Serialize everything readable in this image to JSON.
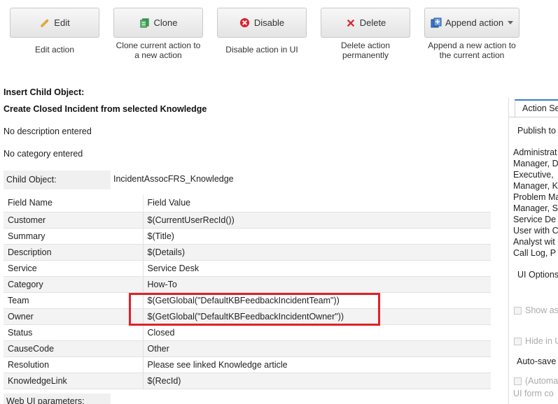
{
  "toolbar": {
    "edit": {
      "label": "Edit",
      "desc": "Edit action",
      "icon": "pencil-icon"
    },
    "clone": {
      "label": "Clone",
      "desc": "Clone current action to a new action",
      "icon": "clone-icon"
    },
    "disable": {
      "label": "Disable",
      "desc": "Disable action in UI",
      "icon": "disable-icon"
    },
    "delete": {
      "label": "Delete",
      "desc": "Delete action permanently",
      "icon": "delete-x-icon"
    },
    "append": {
      "label": "Append action",
      "desc": "Append a new action to the current action",
      "icon": "append-icon"
    }
  },
  "main": {
    "heading": "Insert Child Object:",
    "subheading": "Create Closed Incident from selected Knowledge",
    "description": "No description entered",
    "category": "No category entered",
    "child_object_label": "Child Object:",
    "child_object_value": "IncidentAssocFRS_Knowledge",
    "columns": [
      "Field Name",
      "Field Value"
    ],
    "rows": [
      {
        "name": "Customer",
        "value": "$(CurrentUserRecId())"
      },
      {
        "name": "Summary",
        "value": "$(Title)"
      },
      {
        "name": "Description",
        "value": "$(Details)"
      },
      {
        "name": "Service",
        "value": "Service Desk"
      },
      {
        "name": "Category",
        "value": "How-To"
      },
      {
        "name": "Team",
        "value": "$(GetGlobal(\"DefaultKBFeedbackIncidentTeam\"))"
      },
      {
        "name": "Owner",
        "value": "$(GetGlobal(\"DefaultKBFeedbackIncidentOwner\"))"
      },
      {
        "name": "Status",
        "value": "Closed"
      },
      {
        "name": "CauseCode",
        "value": "Other"
      },
      {
        "name": "Resolution",
        "value": "Please see linked Knowledge article"
      },
      {
        "name": "KnowledgeLink",
        "value": "$(RecId)"
      }
    ],
    "web_ui_label": "Web UI parameters:"
  },
  "right_panel": {
    "tab": "Action Se",
    "publish_to": "Publish to",
    "roles": [
      "Administrat",
      "Manager, D",
      "Executive,",
      "Manager, K",
      "Problem Ma",
      "Manager, S",
      "Service De",
      "User with C",
      "Analyst wit",
      "Call Log, P"
    ],
    "ui_options": "UI Options",
    "show_as": "Show as",
    "hide_in": "Hide in U",
    "auto_save": "Auto-save",
    "automatic": "(Automa",
    "ui_form": "UI form co"
  },
  "colors": {
    "highlight": "#e02128",
    "tab_accent": "#3a7bc8"
  }
}
